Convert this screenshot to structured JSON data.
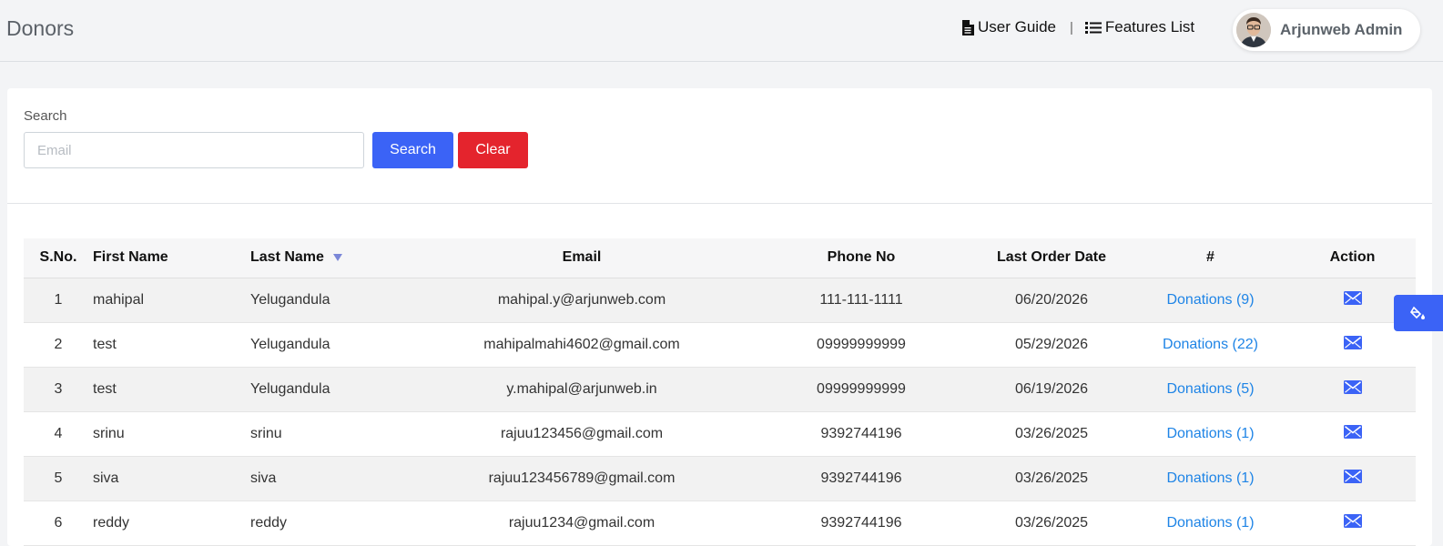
{
  "header": {
    "title": "Donors",
    "user_guide": "User Guide",
    "separator": "|",
    "features_list": "Features List",
    "user_name": "Arjunweb Admin"
  },
  "search": {
    "label": "Search",
    "placeholder": "Email",
    "value": "",
    "search_button": "Search",
    "clear_button": "Clear"
  },
  "table": {
    "headers": [
      "S.No.",
      "First Name",
      "Last Name",
      "Email",
      "Phone No",
      "Last Order Date",
      "#",
      "Action"
    ],
    "sorted_column": "Last Name",
    "rows": [
      {
        "sno": "1",
        "first": "mahipal",
        "last": "Yelugandula",
        "email": "mahipal.y@arjunweb.com",
        "phone": "111-111-1111",
        "date": "06/20/2026",
        "donations": "Donations (9)"
      },
      {
        "sno": "2",
        "first": "test",
        "last": "Yelugandula",
        "email": "mahipalmahi4602@gmail.com",
        "phone": "09999999999",
        "date": "05/29/2026",
        "donations": "Donations (22)"
      },
      {
        "sno": "3",
        "first": "test",
        "last": "Yelugandula",
        "email": "y.mahipal@arjunweb.in",
        "phone": "09999999999",
        "date": "06/19/2026",
        "donations": "Donations (5)"
      },
      {
        "sno": "4",
        "first": "srinu",
        "last": "srinu",
        "email": "rajuu123456@gmail.com",
        "phone": "9392744196",
        "date": "03/26/2025",
        "donations": "Donations (1)"
      },
      {
        "sno": "5",
        "first": "siva",
        "last": "siva",
        "email": "rajuu123456789@gmail.com",
        "phone": "9392744196",
        "date": "03/26/2025",
        "donations": "Donations (1)"
      },
      {
        "sno": "6",
        "first": "reddy",
        "last": "reddy",
        "email": "rajuu1234@gmail.com",
        "phone": "9392744196",
        "date": "03/26/2025",
        "donations": "Donations (1)"
      }
    ]
  },
  "icons": {
    "user_guide": "file-icon",
    "features_list": "list-icon",
    "action": "envelope-icon",
    "sort": "sort-desc-icon",
    "side_tab": "paint-bucket-icon"
  },
  "colors": {
    "primary": "#3b63f6",
    "danger": "#e4242d",
    "link": "#1e84e6"
  }
}
